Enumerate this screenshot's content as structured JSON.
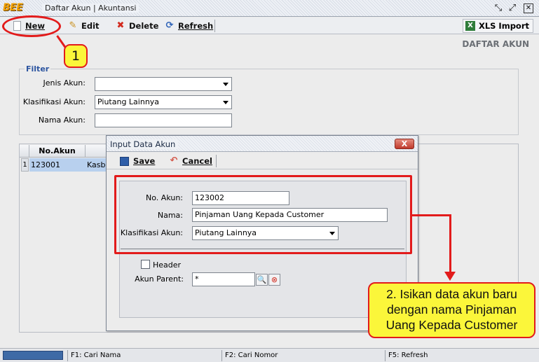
{
  "window": {
    "logo": "BEE",
    "title": "Daftar Akun | Akuntansi",
    "controls": {
      "restore": "⤡",
      "maximize": "⤢",
      "close": "✕"
    }
  },
  "toolbar": {
    "new_label": "New",
    "edit_label": "Edit",
    "delete_label": "Delete",
    "refresh_label": "Refresh",
    "xls_label": "XLS Import"
  },
  "section_title": "DAFTAR AKUN",
  "filter": {
    "legend": "Filter",
    "jenis_akun_label": "Jenis Akun:",
    "jenis_akun_value": "",
    "klasifikasi_label": "Klasifikasi Akun:",
    "klasifikasi_value": "Piutang Lainnya",
    "nama_label": "Nama Akun:",
    "nama_value": ""
  },
  "table": {
    "columns": [
      "No.Akun",
      ""
    ],
    "rows": [
      {
        "num": "1",
        "no_akun": "123001",
        "nama": "Kasbo"
      }
    ]
  },
  "dialog": {
    "title": "Input Data Akun",
    "close_label": "X",
    "save_label": "Save",
    "cancel_label": "Cancel",
    "no_akun_label": "No. Akun:",
    "no_akun_value": "123002",
    "nama_label": "Nama:",
    "nama_value": "Pinjaman Uang Kepada Customer",
    "klasifikasi_label": "Klasifikasi Akun:",
    "klasifikasi_value": "Piutang Lainnya",
    "header_label": "Header",
    "parent_label": "Akun Parent:",
    "parent_value": "*"
  },
  "status": {
    "f1": "F1: Cari Nama",
    "f2": "F2: Cari Nomor",
    "f5": "F5: Refresh"
  },
  "annotations": {
    "step1": "1",
    "step2_line1": "2. Isikan data akun baru",
    "step2_line2": "dengan nama Pinjaman",
    "step2_line3": "Uang Kepada Customer",
    "accent": "#e21b1b",
    "callout_bg": "#fbf63a"
  }
}
